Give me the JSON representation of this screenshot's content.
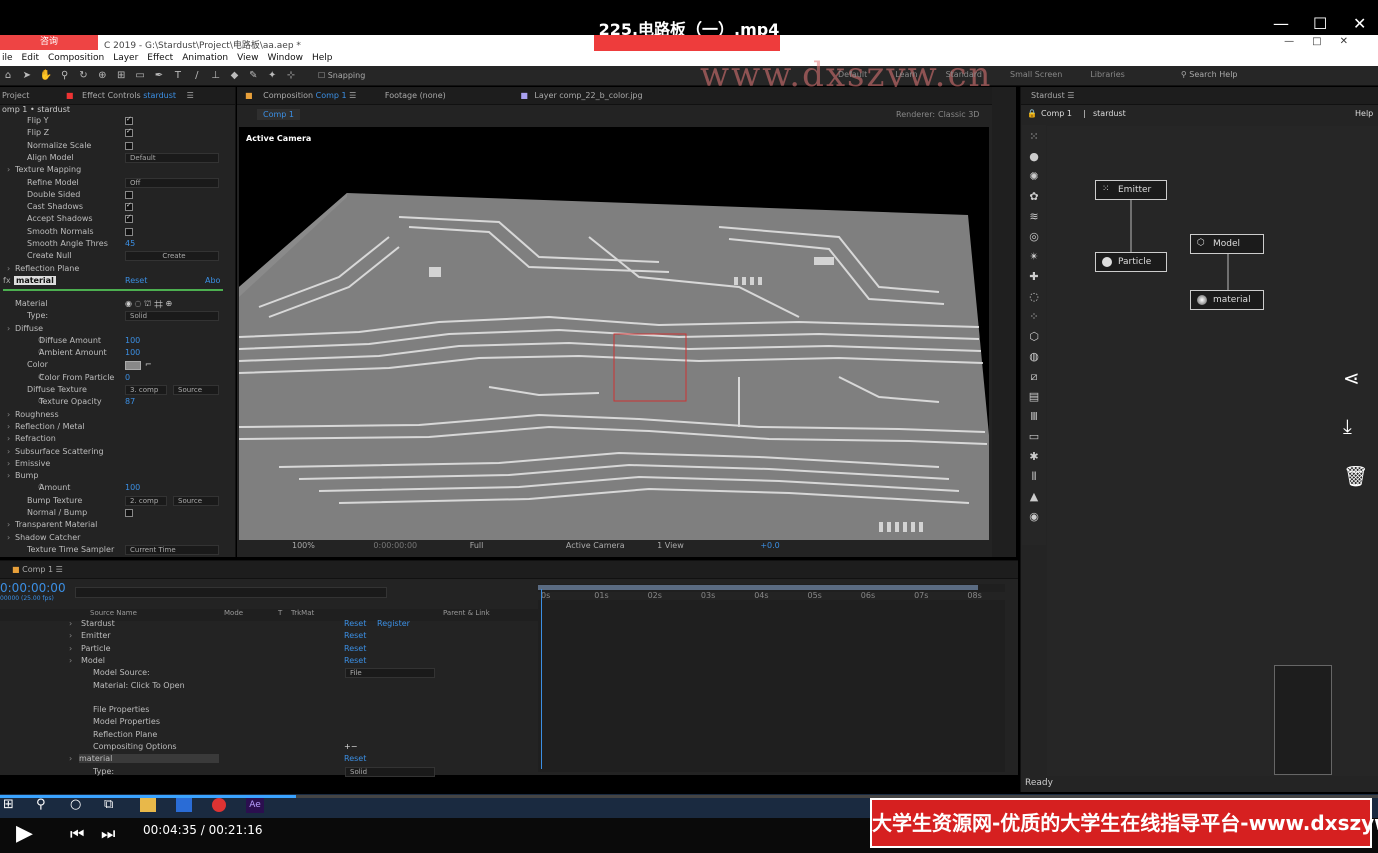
{
  "player": {
    "title": "225.电路板（一）.mp4",
    "current_time": "00:04:35",
    "total_time": "00:21:16",
    "time_display": "00:04:35 / 00:21:16",
    "progress": 0.215,
    "consult_label": "咨询",
    "watermark": "www.dxszyw.cn",
    "banner": "大学生资源网-优质的大学生在线指导平台-www.dxszyw.cn"
  },
  "app": {
    "title": "C 2019 - G:\\Stardust\\Project\\电路板\\aa.aep *",
    "menu": [
      "ile",
      "Edit",
      "Composition",
      "Layer",
      "Effect",
      "Animation",
      "View",
      "Window",
      "Help"
    ],
    "snapping_label": "Snapping",
    "workspaces": [
      "Default",
      "Learn",
      "Standard",
      "Small Screen",
      "Libraries"
    ],
    "search_help": "Search Help"
  },
  "effect_controls": {
    "tab_project": "Project",
    "tab_label": "Effect Controls",
    "tab_layer": "stardust",
    "breadcrumb": "omp 1 • stardust",
    "rows": [
      {
        "label": "Flip Y",
        "type": "check",
        "on": true
      },
      {
        "label": "Flip Z",
        "type": "check",
        "on": true
      },
      {
        "label": "Normalize Scale",
        "type": "check",
        "on": false
      },
      {
        "label": "Align Model",
        "type": "select",
        "value": "Default"
      },
      {
        "label": "Texture Mapping",
        "type": "group"
      },
      {
        "label": "Refine Model",
        "type": "select",
        "value": "Off"
      },
      {
        "label": "Double Sided",
        "type": "check",
        "on": false
      },
      {
        "label": "Cast Shadows",
        "type": "check",
        "on": true
      },
      {
        "label": "Accept Shadows",
        "type": "check",
        "on": true
      },
      {
        "label": "Smooth Normals",
        "type": "check",
        "on": false
      },
      {
        "label": "Smooth Angle Thres",
        "type": "value",
        "value": "45"
      },
      {
        "label": "Create Null",
        "type": "button",
        "value": "Create"
      },
      {
        "label": "Reflection Plane",
        "type": "group"
      }
    ],
    "material_label": "material",
    "reset_label": "Reset",
    "about_label": "Abo",
    "material_section": "Material",
    "mat_rows": [
      {
        "label": "Type:",
        "type": "select",
        "value": "Solid"
      },
      {
        "label": "Diffuse",
        "type": "group"
      },
      {
        "label": "Diffuse Amount",
        "type": "value",
        "value": "100"
      },
      {
        "label": "Ambient Amount",
        "type": "value",
        "value": "100"
      },
      {
        "label": "Color",
        "type": "color"
      },
      {
        "label": "Color From Particle",
        "type": "value",
        "value": "0"
      },
      {
        "label": "Diffuse Texture",
        "type": "select",
        "value": "3. comp",
        "value2": "Source"
      },
      {
        "label": "Texture Opacity",
        "type": "value",
        "value": "87"
      },
      {
        "label": "Roughness",
        "type": "group"
      },
      {
        "label": "Reflection / Metal",
        "type": "group"
      },
      {
        "label": "Refraction",
        "type": "group"
      },
      {
        "label": "Subsurface Scattering",
        "type": "group"
      },
      {
        "label": "Emissive",
        "type": "group"
      },
      {
        "label": "Bump",
        "type": "group"
      },
      {
        "label": "Amount",
        "type": "value",
        "value": "100"
      },
      {
        "label": "Bump Texture",
        "type": "select",
        "value": "2. comp",
        "value2": "Source"
      },
      {
        "label": "Normal / Bump",
        "type": "check",
        "on": false
      },
      {
        "label": "Transparent Material",
        "type": "group"
      },
      {
        "label": "Shadow Catcher",
        "type": "group"
      },
      {
        "label": "Texture Time Sampler",
        "type": "select",
        "value": "Current Time"
      }
    ]
  },
  "composition": {
    "tab": "Composition",
    "tab_comp": "Comp 1",
    "footage": "Footage (none)",
    "layer_tab": "Layer comp_22_b_color.jpg",
    "comp_chip": "Comp 1",
    "renderer_label": "Renderer:",
    "renderer_value": "Classic 3D",
    "active_camera": "Active Camera",
    "zoom": "100%",
    "timecode": "0:00:00:00",
    "resolution": "Full",
    "camera_select": "Active Camera",
    "views": "1 View",
    "exposure": "+0.0"
  },
  "stardust": {
    "panel_title": "Stardust",
    "comp": "Comp 1",
    "layer": "stardust",
    "help": "Help",
    "nodes": [
      {
        "label": "Emitter",
        "icon": "emitter-icon"
      },
      {
        "label": "Particle",
        "icon": "particle-icon"
      },
      {
        "label": "Model",
        "icon": "model-icon"
      },
      {
        "label": "material",
        "icon": "material-icon"
      }
    ],
    "status": "Ready"
  },
  "timeline": {
    "tab": "Comp 1",
    "timecode": "0:00:00:00",
    "fps": "00000 (25.00 fps)",
    "col_source": "Source Name",
    "col_mode": "Mode",
    "col_t": "T",
    "col_trkmat": "TrkMat",
    "col_parent": "Parent & Link",
    "ruler": [
      "0s",
      "01s",
      "02s",
      "03s",
      "04s",
      "05s",
      "06s",
      "07s",
      "08s"
    ],
    "rows": [
      {
        "label": "Stardust",
        "indent": 1,
        "action": "Reset",
        "extra": "Register"
      },
      {
        "label": "Emitter",
        "indent": 1,
        "action": "Reset"
      },
      {
        "label": "Particle",
        "indent": 1,
        "action": "Reset"
      },
      {
        "label": "Model",
        "indent": 1,
        "action": "Reset"
      },
      {
        "label": "Model Source:",
        "indent": 2,
        "select": "File"
      },
      {
        "label": "Material: Click To Open",
        "indent": 2
      },
      {
        "label": "",
        "indent": 2
      },
      {
        "label": "File Properties",
        "indent": 2
      },
      {
        "label": "Model Properties",
        "indent": 2
      },
      {
        "label": "Reflection Plane",
        "indent": 2
      },
      {
        "label": "Compositing Options",
        "indent": 2,
        "extra": "+−"
      },
      {
        "label": "material",
        "indent": 1,
        "action": "Reset"
      },
      {
        "label": "Type:",
        "indent": 2,
        "select": "Solid"
      }
    ]
  }
}
